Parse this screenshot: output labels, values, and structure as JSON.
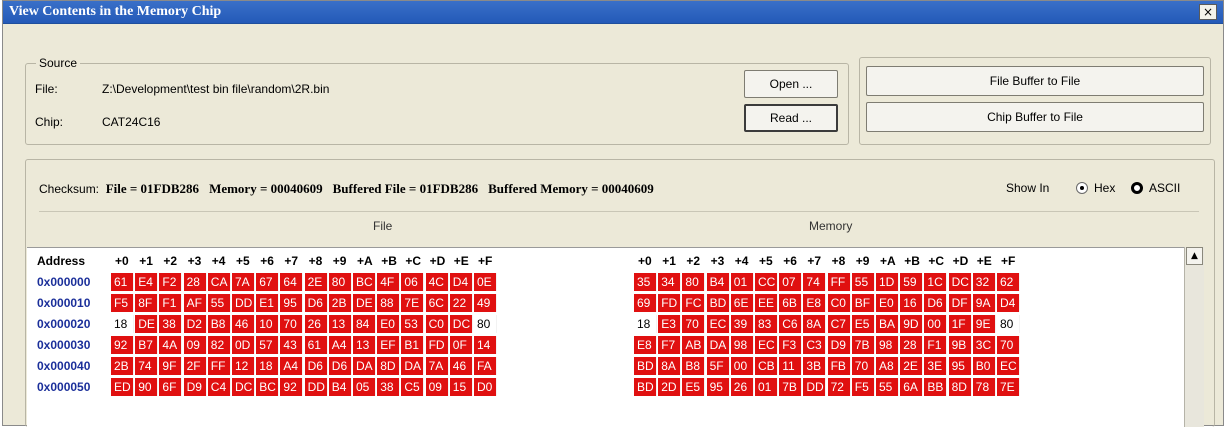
{
  "window": {
    "title": "View Contents in the Memory Chip",
    "close_label": "×"
  },
  "source": {
    "legend": "Source",
    "file_label": "File:",
    "file_value": "Z:\\Development\\test bin file\\random\\2R.bin",
    "chip_label": "Chip:",
    "chip_value": "CAT24C16"
  },
  "buttons": {
    "open": "Open ...",
    "read": "Read ...",
    "file_buffer_to_file": "File Buffer to File",
    "chip_buffer_to_file": "Chip Buffer to File"
  },
  "checksum": {
    "label": "Checksum:",
    "file": "File = 01FDB286",
    "memory": "Memory = 00040609",
    "buffered_file": "Buffered File = 01FDB286",
    "buffered_memory": "Buffered Memory = 00040609"
  },
  "show_in": {
    "label": "Show In",
    "options": [
      "Hex",
      "ASCII"
    ],
    "selected": "Hex"
  },
  "sections": {
    "file": "File",
    "memory": "Memory"
  },
  "columns": {
    "address": "Address",
    "offsets": [
      "+0",
      "+1",
      "+2",
      "+3",
      "+4",
      "+5",
      "+6",
      "+7",
      "+8",
      "+9",
      "+A",
      "+B",
      "+C",
      "+D",
      "+E",
      "+F"
    ]
  },
  "rows": [
    {
      "address": "0x000000",
      "file": [
        "61",
        "E4",
        "F2",
        "28",
        "CA",
        "7A",
        "67",
        "64",
        "2E",
        "80",
        "BC",
        "4F",
        "06",
        "4C",
        "D4",
        "0E"
      ],
      "memory": [
        "35",
        "34",
        "80",
        "B4",
        "01",
        "CC",
        "07",
        "74",
        "FF",
        "55",
        "1D",
        "59",
        "1C",
        "DC",
        "32",
        "62"
      ]
    },
    {
      "address": "0x000010",
      "file": [
        "F5",
        "8F",
        "F1",
        "AF",
        "55",
        "DD",
        "E1",
        "95",
        "D6",
        "2B",
        "DE",
        "88",
        "7E",
        "6C",
        "22",
        "49"
      ],
      "memory": [
        "69",
        "FD",
        "FC",
        "BD",
        "6E",
        "EE",
        "6B",
        "E8",
        "C0",
        "BF",
        "E0",
        "16",
        "D6",
        "DF",
        "9A",
        "D4"
      ]
    },
    {
      "address": "0x000020",
      "file": [
        "18",
        "DE",
        "38",
        "D2",
        "B8",
        "46",
        "10",
        "70",
        "26",
        "13",
        "84",
        "E0",
        "53",
        "C0",
        "DC",
        "80"
      ],
      "memory": [
        "18",
        "E3",
        "70",
        "EC",
        "39",
        "83",
        "C6",
        "8A",
        "C7",
        "E5",
        "BA",
        "9D",
        "00",
        "1F",
        "9E",
        "80"
      ]
    },
    {
      "address": "0x000030",
      "file": [
        "92",
        "B7",
        "4A",
        "09",
        "82",
        "0D",
        "57",
        "43",
        "61",
        "A4",
        "13",
        "EF",
        "B1",
        "FD",
        "0F",
        "14"
      ],
      "memory": [
        "E8",
        "F7",
        "AB",
        "DA",
        "98",
        "EC",
        "F3",
        "C3",
        "D9",
        "7B",
        "98",
        "28",
        "F1",
        "9B",
        "3C",
        "70"
      ]
    },
    {
      "address": "0x000040",
      "file": [
        "2B",
        "74",
        "9F",
        "2F",
        "FF",
        "12",
        "18",
        "A4",
        "D6",
        "D6",
        "DA",
        "8D",
        "DA",
        "7A",
        "46",
        "FA"
      ],
      "memory": [
        "BD",
        "8A",
        "B8",
        "5F",
        "00",
        "CB",
        "11",
        "3B",
        "FB",
        "70",
        "A8",
        "2E",
        "3E",
        "95",
        "B0",
        "EC"
      ]
    },
    {
      "address": "0x000050",
      "file": [
        "ED",
        "90",
        "6F",
        "D9",
        "C4",
        "DC",
        "BC",
        "92",
        "DD",
        "B4",
        "05",
        "38",
        "C5",
        "09",
        "15",
        "D0"
      ],
      "memory": [
        "BD",
        "2D",
        "E5",
        "95",
        "26",
        "01",
        "7B",
        "DD",
        "72",
        "F5",
        "55",
        "6A",
        "BB",
        "8D",
        "78",
        "7E"
      ]
    }
  ],
  "highlight": {
    "match_color": "#ffffff",
    "diff_color": "#e01010"
  },
  "matching_cells": [
    {
      "row": 2,
      "col": 0
    },
    {
      "row": 2,
      "col": 15
    }
  ]
}
